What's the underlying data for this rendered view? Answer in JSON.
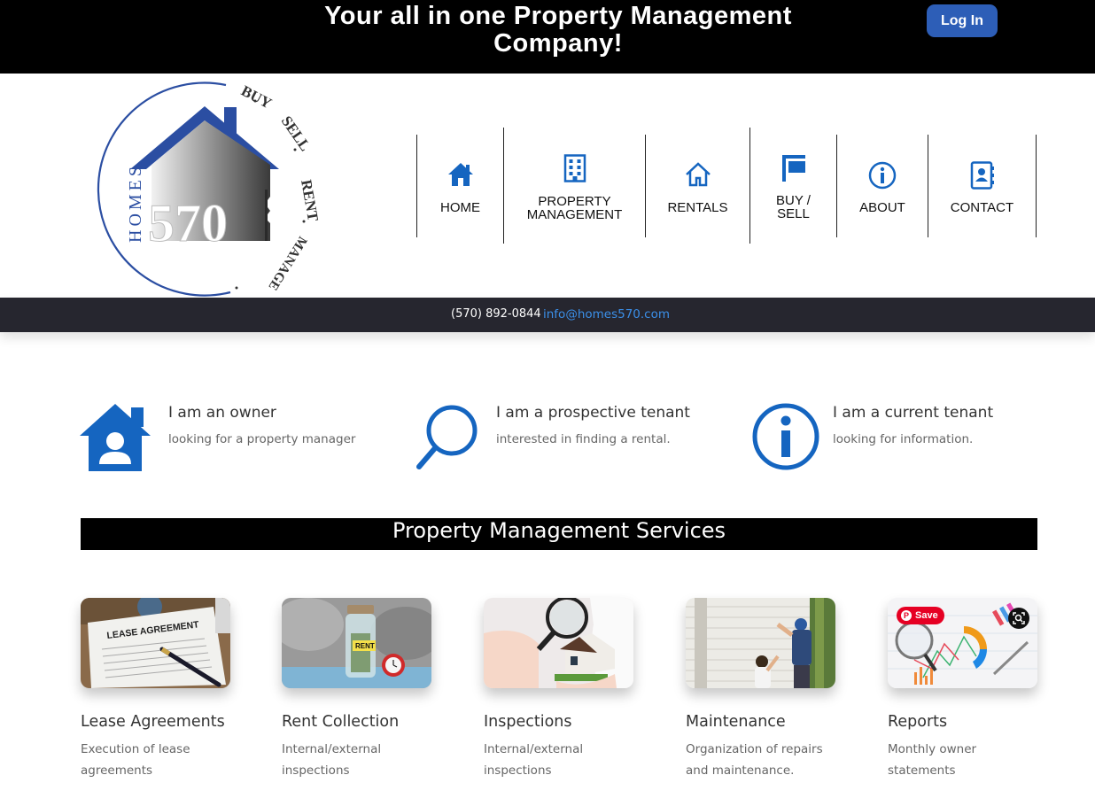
{
  "top_bar": {
    "tagline": "Your all in one Property Management Company!",
    "login_label": "Log In"
  },
  "logo": {
    "wordmark": "HOMES",
    "number": "570",
    "ring_words": [
      "BUY",
      "SELL",
      "RENT",
      "MANAGE"
    ]
  },
  "nav": {
    "items": [
      {
        "label": "HOME",
        "icon": "home-icon"
      },
      {
        "label": "PROPERTY MANAGEMENT",
        "line1": "PROPERTY",
        "line2": "MANAGEMENT",
        "icon": "building-icon"
      },
      {
        "label": "RENTALS",
        "icon": "house-outline-icon"
      },
      {
        "label": "BUY / SELL",
        "line1": "BUY /",
        "line2": "SELL",
        "icon": "signpost-icon"
      },
      {
        "label": "ABOUT",
        "icon": "info-icon"
      },
      {
        "label": "CONTACT",
        "icon": "address-book-icon"
      }
    ]
  },
  "contact_bar": {
    "phone": "(570) 892-0844",
    "email": "info@homes570.com"
  },
  "personas": [
    {
      "title": "I am an owner",
      "subtitle": "looking for a property manager",
      "icon": "owner-house-icon"
    },
    {
      "title": "I am a prospective tenant",
      "subtitle": "interested in finding a rental.",
      "icon": "magnifier-icon"
    },
    {
      "title": "I am a current tenant",
      "subtitle": "looking for information.",
      "icon": "info-circle-icon"
    }
  ],
  "services": {
    "heading": "Property Management Services",
    "items": [
      {
        "title": "Lease Agreements",
        "description": "Execution of lease agreements",
        "image_text": "LEASE AGREEMENT"
      },
      {
        "title": "Rent Collection",
        "description": "Internal/external inspections",
        "image_text": "RENT"
      },
      {
        "title": "Inspections",
        "description": "Internal/external inspections"
      },
      {
        "title": "Maintenance",
        "description": "Organization of repairs and maintenance."
      },
      {
        "title": "Reports",
        "description": "Monthly owner statements"
      }
    ],
    "save_label": "Save"
  },
  "colors": {
    "brand_blue": "#1565c0",
    "login_blue": "#2d5eb7",
    "top_bar": "#000000",
    "contact_bar": "#26262f",
    "link_blue": "#3b8fe8",
    "pinterest_red": "#e60023"
  }
}
